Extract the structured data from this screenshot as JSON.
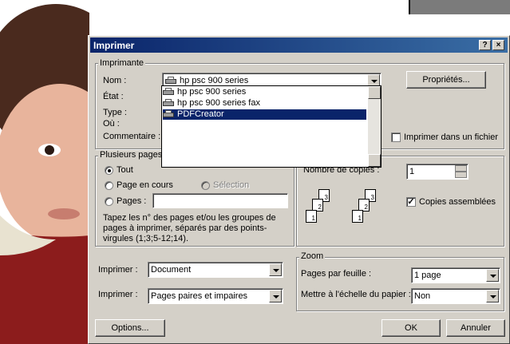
{
  "dialog": {
    "title": "Imprimer",
    "help_btn": "?",
    "close_btn": "×"
  },
  "printer_group": {
    "legend": "Imprimante",
    "name_label": "Nom :",
    "selected_printer": "hp psc 900 series",
    "options": [
      "hp psc 900 series",
      "hp psc 900 series fax",
      "PDFCreator"
    ],
    "highlighted_index": 2,
    "state_label": "État :",
    "type_label": "Type :",
    "where_label": "Où :",
    "comment_label": "Commentaire :",
    "properties_btn": "Propriétés...",
    "print_to_file_label": "Imprimer dans un fichier",
    "print_to_file_checked": false
  },
  "pages_group": {
    "legend": "Plusieurs pages",
    "all_label": "Tout",
    "current_label": "Page en cours",
    "selection_label": "Sélection",
    "pages_label": "Pages :",
    "pages_value": "",
    "selected": "all",
    "help_text": "Tapez les n° des pages et/ou les groupes de pages à imprimer, séparés par des points-virgules (1;3;5-12;14)."
  },
  "copies_group": {
    "copies_label": "Nombre de copies :",
    "copies_value": "1",
    "collate_label": "Copies assemblées",
    "collate_checked": true,
    "page_numbers": [
      "1",
      "2",
      "3"
    ]
  },
  "print_what": {
    "label": "Imprimer :",
    "value": "Document"
  },
  "print_range": {
    "label": "Imprimer :",
    "value": "Pages paires et impaires"
  },
  "zoom_group": {
    "legend": "Zoom",
    "pages_per_sheet_label": "Pages par feuille :",
    "pages_per_sheet_value": "1 page",
    "scale_label": "Mettre à l'échelle du papier :",
    "scale_value": "Non"
  },
  "buttons": {
    "options": "Options...",
    "ok": "OK",
    "cancel": "Annuler"
  },
  "colors": {
    "dialog_bg": "#d4d0c8",
    "titlebar": "#0a246a",
    "selection": "#0a246a"
  }
}
